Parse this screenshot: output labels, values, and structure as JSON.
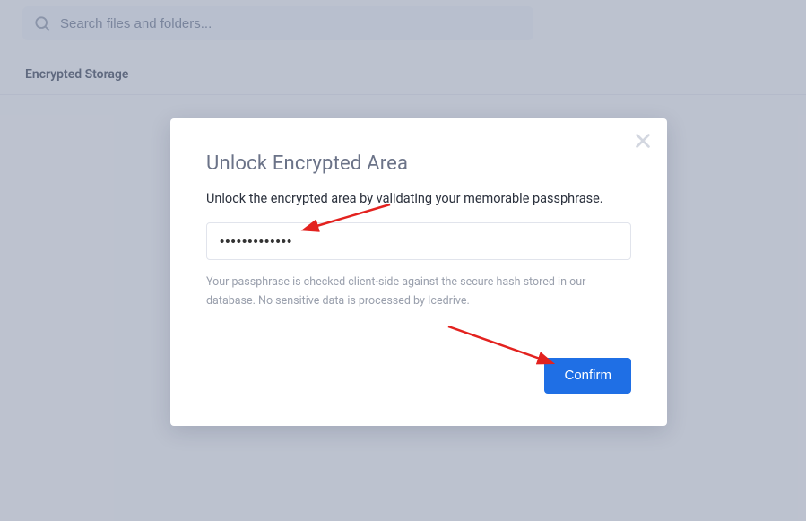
{
  "search": {
    "placeholder": "Search files and folders..."
  },
  "breadcrumb": {
    "title": "Encrypted Storage"
  },
  "modal": {
    "title": "Unlock Encrypted Area",
    "description": "Unlock the encrypted area by validating your memorable passphrase.",
    "passphrase_value": "•••••••••••••",
    "hint": "Your passphrase is checked client-side against the secure hash stored in our database. No sensitive data is processed by Icedrive.",
    "confirm_label": "Confirm"
  }
}
